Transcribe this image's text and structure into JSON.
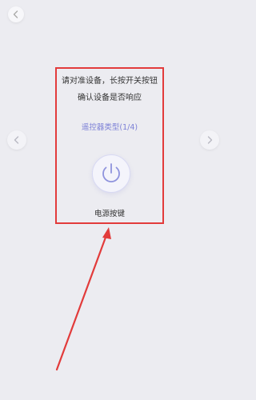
{
  "header": {
    "back_icon": "chevron-left-icon"
  },
  "instructions": {
    "line1": "请对准设备，长按开关按钮",
    "line2": "确认设备是否响应"
  },
  "remote_type": "遥控器类型(1/4)",
  "power_button": {
    "label": "电源按键",
    "icon": "power-icon"
  },
  "navigation": {
    "prev_icon": "chevron-left-icon",
    "next_icon": "chevron-right-icon"
  },
  "colors": {
    "highlight_border": "#e23b3b",
    "accent": "#7b7fd6",
    "background": "#ececf1"
  }
}
